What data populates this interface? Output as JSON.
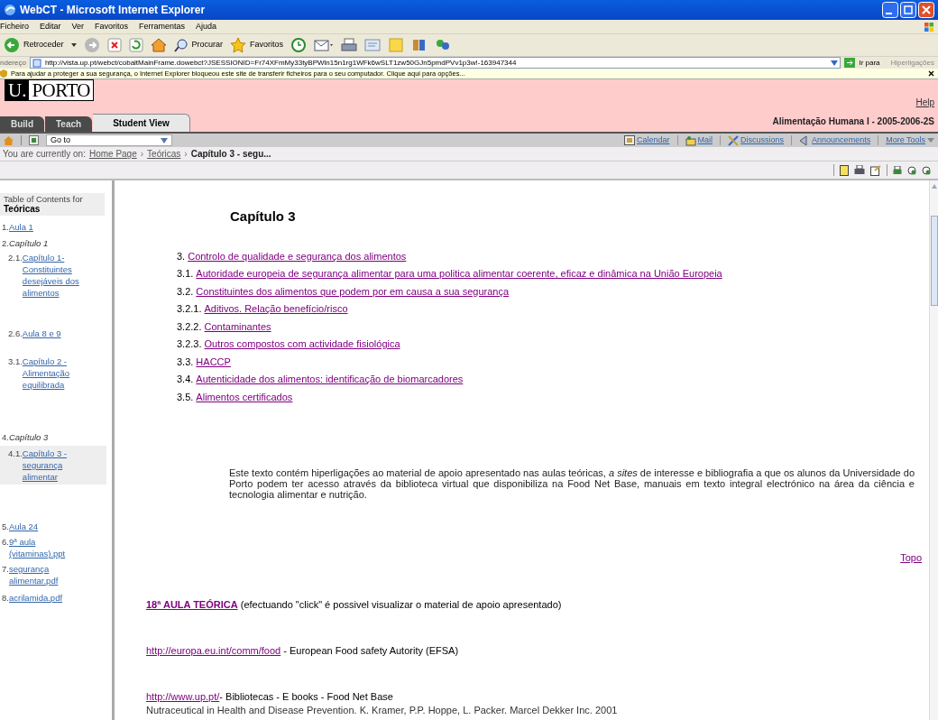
{
  "window": {
    "title": "WebCT - Microsoft Internet Explorer"
  },
  "menu": [
    "Ficheiro",
    "Editar",
    "Ver",
    "Favoritos",
    "Ferramentas",
    "Ajuda"
  ],
  "toolbar": {
    "back": "Retroceder",
    "search": "Procurar",
    "favorites": "Favoritos"
  },
  "address": {
    "label": "ndereço",
    "url": "http://vista.up.pt/webct/cobaltMainFrame.dowebct?JSESSIONID=Fr74XFmMy33tyBPWln15n1rg1WFk6wSLT1zw50GJn5pmdPVv1p3w!-163947344",
    "go": "Ir para",
    "links": "Hiperligações"
  },
  "info_bar": "Para ajudar a proteger a sua segurança, o Internet Explorer bloqueou este site de transferir ficheiros para o seu computador. Clique aqui para opções...",
  "header": {
    "logo_mark": "U.",
    "logo_text": "PORTO",
    "help": "Help",
    "course": "Alimentação Humana I - 2005-2006-2S",
    "tabs": [
      {
        "label": "Build",
        "selected": false
      },
      {
        "label": "Teach",
        "selected": false
      },
      {
        "label": "Student View",
        "selected": true
      }
    ]
  },
  "nav": {
    "goto": "Go to",
    "tools": [
      {
        "kind": "calendar",
        "label": "Calendar"
      },
      {
        "kind": "mail",
        "label": "Mail"
      },
      {
        "kind": "discussions",
        "label": "Discussions"
      },
      {
        "kind": "announcements",
        "label": "Announcements"
      },
      {
        "kind": "more",
        "label": "More Tools"
      }
    ]
  },
  "breadcrumb": {
    "prefix": "You are currently on:",
    "links": [
      {
        "label": "Home Page",
        "separator": "›"
      },
      {
        "label": "Teóricas",
        "separator": "›"
      }
    ],
    "current": "Capítulo 3 - segu..."
  },
  "sidebar": {
    "heading": "Table of Contents for",
    "title": "Teóricas",
    "items": [
      {
        "num": "1.",
        "label": "Aula 1",
        "kind": "link",
        "selected": false
      },
      {
        "num": "2.",
        "label": "Capítulo 1",
        "kind": "folder",
        "selected": false,
        "children": [
          {
            "num": "2.1.",
            "label": "Capítulo 1- Constituintes desejáveis dos alimentos",
            "kind": "link",
            "selected": false
          },
          {
            "num": "2.6.",
            "label": "Aula 8 e 9",
            "kind": "link",
            "selected": false
          },
          {
            "num": "3.1.",
            "label": "Capítulo 2 - Alimentação equilibrada",
            "kind": "link",
            "selected": false
          }
        ]
      },
      {
        "num": "4.",
        "label": "Capítulo 3",
        "kind": "folder",
        "selected": false,
        "children": [
          {
            "num": "4.1.",
            "label": "Capítulo 3 - segurança alimentar",
            "kind": "link",
            "selected": true
          }
        ]
      },
      {
        "num": "5.",
        "label": "Aula 24",
        "kind": "link",
        "selected": false
      },
      {
        "num": "6.",
        "label": "9ª aula (vitaminas).ppt",
        "kind": "link",
        "selected": false
      },
      {
        "num": "7.",
        "label": "segurança alimentar.pdf",
        "kind": "link",
        "selected": false
      },
      {
        "num": "8.",
        "label": "acrilamida.pdf",
        "kind": "link",
        "selected": false
      }
    ]
  },
  "content": {
    "heading": "Capítulo 3",
    "toc": [
      {
        "num": "3.",
        "text": "Controlo de qualidade e segurança dos alimentos"
      },
      {
        "num": "3.1.",
        "text": "Autoridade europeia de segurança alimentar para uma politica alimentar coerente, eficaz e dinâmica na União Europeia"
      },
      {
        "num": "3.2.",
        "text": "Constituintes dos alimentos que podem por em causa a sua segurança"
      },
      {
        "num": "3.2.1.",
        "text": "Aditivos. Relação benefício/risco"
      },
      {
        "num": "3.2.2.",
        "text": "Contaminantes"
      },
      {
        "num": "3.2.3.",
        "text": "Outros compostos com actividade fisiológica"
      },
      {
        "num": "3.3.",
        "text": "HACCP"
      },
      {
        "num": "3.4.",
        "text": "Autenticidade dos alimentos: identificação de biomarcadores"
      },
      {
        "num": "3.5.",
        "text": "Alimentos certificados"
      }
    ],
    "paragraph": "Este texto contém hiperligações ao material de apoio apresentado nas aulas teóricas, *a sites* de interesse e bibliografia a que os alunos da Universidade do Porto podem ter acesso através da biblioteca virtual que disponibiliza na Food Net Base, manuais em texto integral electrónico na área da ciência e tecnologia alimentar e nutrição.",
    "topo": "Topo",
    "entries": [
      {
        "link": "18ª AULA TEÓRICA",
        "text": " (efectuando \"click\" é possivel visualizar o material de apoio apresentado)",
        "bold": true
      },
      {
        "link": "http://europa.eu.int/comm/food",
        "text": " - European Food safety Autority (EFSA)",
        "bold": false
      },
      {
        "link": "http://www.up.pt/",
        "text": "- Bibliotecas - E books - Food Net Base",
        "bold": false
      }
    ],
    "last_line": "Nutraceutical in Health and Disease Prevention. K. Kramer, P.P. Hoppe, L. Packer. Marcel Dekker Inc. 2001"
  }
}
